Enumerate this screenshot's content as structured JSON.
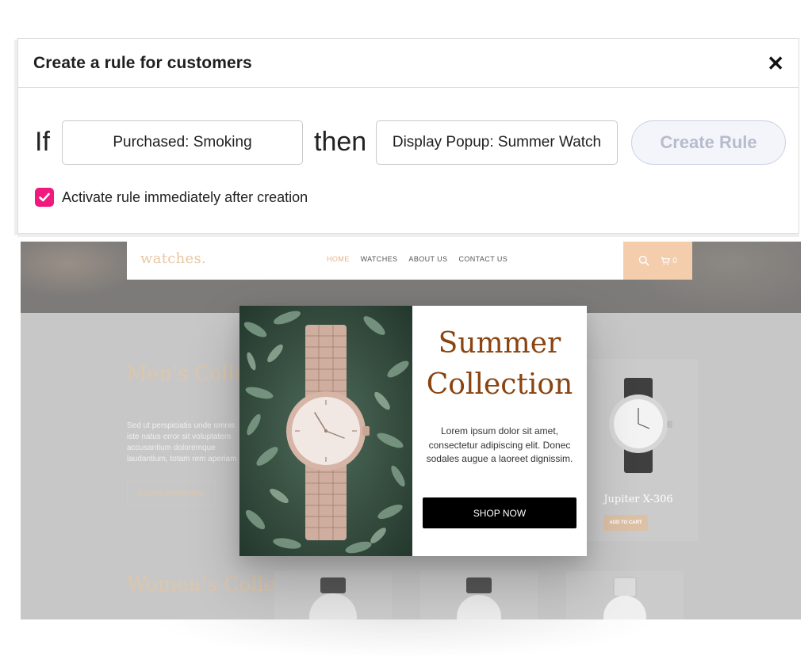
{
  "rule_dialog": {
    "title": "Create a rule for customers",
    "if_keyword": "If",
    "condition_value": "Purchased: Smoking",
    "then_keyword": "then",
    "action_value": "Display Popup: Summer Watch",
    "create_button": "Create Rule",
    "activate_label": "Activate rule immediately after creation",
    "activate_checked": true,
    "accent_color": "#f0197d"
  },
  "site": {
    "logo": "watches.",
    "nav": [
      "HOME",
      "WATCHES",
      "ABOUT US",
      "CONTACT US"
    ],
    "cart_count": "0",
    "men": {
      "title": "Men’s Collection",
      "description": "Sed ut perspiciatis unde omnis iste natus error sit voluptatem accusantium doloremque laudantium, totam rem aperiam",
      "button": "START SHOPPING"
    },
    "product": {
      "name": "Jupiter X-306",
      "button": "ADD TO CART"
    },
    "women": {
      "title": "Women’s Collection"
    },
    "accent_color": "#e8c7a3"
  },
  "popup": {
    "heading": "Summer Collection",
    "body": "Lorem ipsum dolor sit amet, consectetur adipiscing elit. Donec sodales augue a laoreet dignissim.",
    "button": "SHOP NOW",
    "heading_color": "#8a4410"
  }
}
